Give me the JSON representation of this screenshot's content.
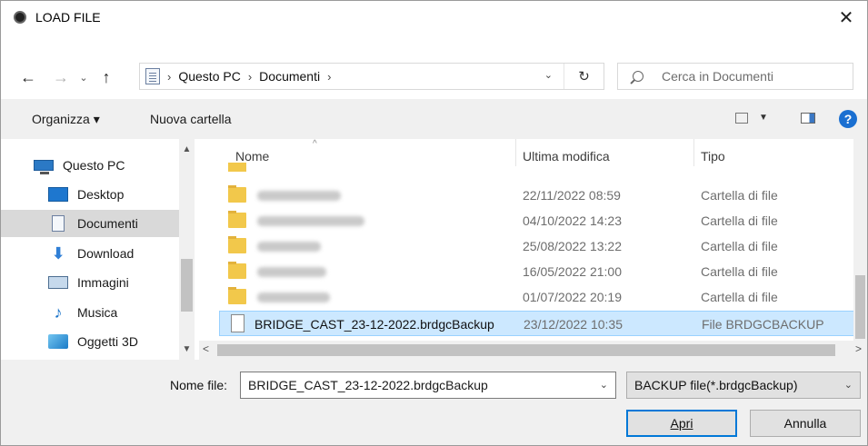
{
  "window": {
    "title": "LOAD FILE",
    "close_glyph": "✕"
  },
  "nav": {
    "back_glyph": "←",
    "forward_glyph": "→",
    "recent_glyph": "⌄",
    "up_glyph": "↑",
    "breadcrumb": [
      "Questo PC",
      "Documenti"
    ],
    "separator": "›",
    "dropdown_glyph": "⌄",
    "refresh_glyph": "↻",
    "search_placeholder": "Cerca in Documenti"
  },
  "commands": {
    "organize": "Organizza ▾",
    "new_folder": "Nuova cartella",
    "view_caret": "▼",
    "help": "?"
  },
  "sidebar": {
    "items": [
      {
        "label": "Questo PC",
        "icon": "computer-icon"
      },
      {
        "label": "Desktop",
        "icon": "desktop-icon"
      },
      {
        "label": "Documenti",
        "icon": "documents-icon",
        "selected": true
      },
      {
        "label": "Download",
        "icon": "download-icon"
      },
      {
        "label": "Immagini",
        "icon": "images-icon"
      },
      {
        "label": "Musica",
        "icon": "music-icon"
      },
      {
        "label": "Oggetti 3D",
        "icon": "objects-3d-icon"
      }
    ],
    "scroll_up": "▲",
    "scroll_down": "▼"
  },
  "filelist": {
    "columns": {
      "name": "Nome",
      "modified": "Ultima modifica",
      "type": "Tipo"
    },
    "sort_glyph": "^",
    "rows": [
      {
        "name": "",
        "date": "22/11/2022 08:59",
        "type": "Cartella di file",
        "kind": "folder"
      },
      {
        "name": "",
        "date": "04/10/2022 14:23",
        "type": "Cartella di file",
        "kind": "folder"
      },
      {
        "name": "",
        "date": "25/08/2022 13:22",
        "type": "Cartella di file",
        "kind": "folder"
      },
      {
        "name": "",
        "date": "16/05/2022 21:00",
        "type": "Cartella di file",
        "kind": "folder"
      },
      {
        "name": "",
        "date": "01/07/2022 20:19",
        "type": "Cartella di file",
        "kind": "folder"
      },
      {
        "name": "BRIDGE_CAST_23-12-2022.brdgcBackup",
        "date": "23/12/2022 10:35",
        "type": "File BRDGCBACKUP",
        "kind": "file",
        "selected": true
      }
    ],
    "hscroll_left": "<",
    "hscroll_right": ">"
  },
  "footer": {
    "filename_label": "Nome file:",
    "filename_value": "BRIDGE_CAST_23-12-2022.brdgcBackup",
    "filetype_value": "BACKUP file(*.brdgcBackup)",
    "caret": "⌄",
    "open_label": "Apri",
    "cancel_label": "Annulla"
  }
}
